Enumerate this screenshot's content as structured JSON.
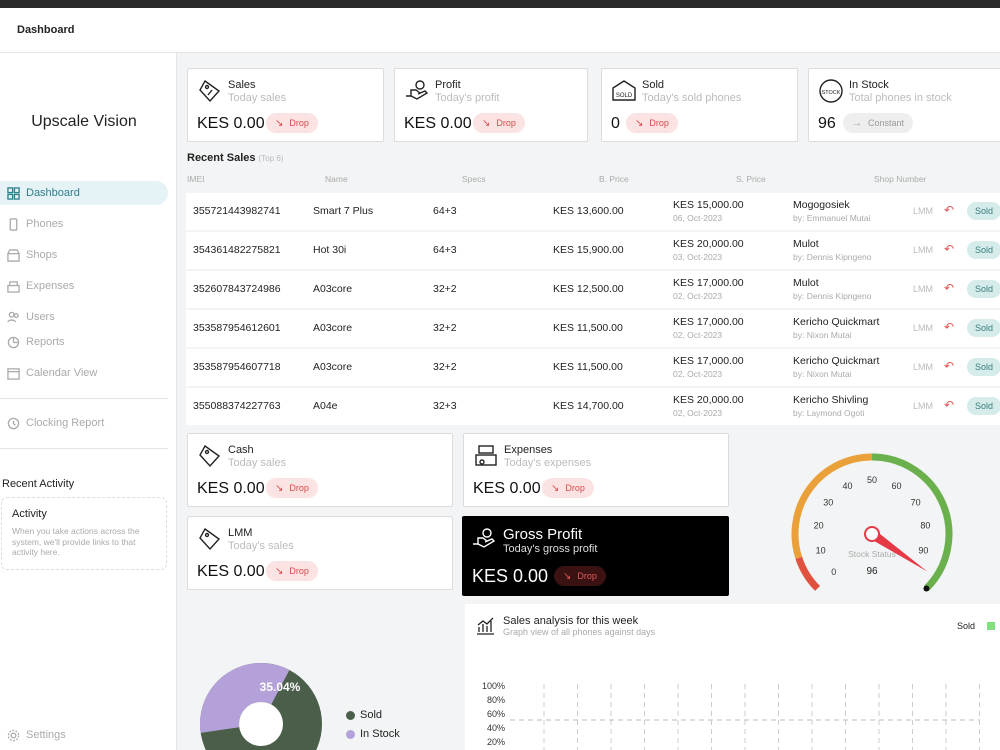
{
  "topbar": {
    "title": "Dashboard"
  },
  "brand": "Upscale Vision",
  "nav": [
    {
      "label": "Dashboard",
      "icon": "grid-icon",
      "active": true
    },
    {
      "label": "Phones",
      "icon": "phone-icon"
    },
    {
      "label": "Shops",
      "icon": "shop-icon"
    },
    {
      "label": "Expenses",
      "icon": "expenses-icon"
    },
    {
      "label": "Users",
      "icon": "users-icon"
    },
    {
      "label": "Reports",
      "icon": "reports-icon"
    },
    {
      "label": "Calendar View",
      "icon": "calendar-icon"
    },
    {
      "label": "Clocking Report",
      "icon": "clock-icon"
    },
    {
      "label": "Settings",
      "icon": "gear-icon"
    }
  ],
  "recent_activity": {
    "title": "Recent Activity",
    "box_title": "Activity",
    "box_text": "When you take actions across the system, we'll provide links to that activity here."
  },
  "stats": [
    {
      "title": "Sales",
      "subtitle": "Today sales",
      "value": "KES 0.00",
      "badge": "Drop",
      "icon": "sales-tag-icon"
    },
    {
      "title": "Profit",
      "subtitle": "Today's profit",
      "value": "KES 0.00",
      "badge": "Drop",
      "icon": "profit-hand-icon"
    },
    {
      "title": "Sold",
      "subtitle": "Today's sold phones",
      "value": "0",
      "badge": "Drop",
      "icon": "sold-stamp-icon"
    },
    {
      "title": "In Stock",
      "subtitle": "Total phones in stock",
      "value": "96",
      "badge": "Constant",
      "icon": "stock-stamp-icon"
    }
  ],
  "recent_sales": {
    "title": "Recent Sales",
    "hint": "(Top 6)",
    "headers": [
      "IMEI",
      "Name",
      "Specs",
      "B. Price",
      "S. Price",
      "Shop Number"
    ],
    "rows": [
      {
        "imei": "355721443982741",
        "name": "Smart 7 Plus",
        "specs": "64+3",
        "bprice": "KES 13,600.00",
        "sprice": "KES 15,000.00",
        "date": "06, Oct-2023",
        "shop": "Mogogosiek",
        "by": "by: Emmanuel Mutai",
        "lmm": "LMM",
        "status": "Sold"
      },
      {
        "imei": "354361482275821",
        "name": "Hot 30i",
        "specs": "64+3",
        "bprice": "KES 15,900.00",
        "sprice": "KES 20,000.00",
        "date": "03, Oct-2023",
        "shop": "Mulot",
        "by": "by: Dennis  Kipngeno",
        "lmm": "LMM",
        "status": "Sold"
      },
      {
        "imei": "352607843724986",
        "name": "A03core",
        "specs": "32+2",
        "bprice": "KES 12,500.00",
        "sprice": "KES 17,000.00",
        "date": "02, Oct-2023",
        "shop": "Mulot",
        "by": "by: Dennis  Kipngeno",
        "lmm": "LMM",
        "status": "Sold"
      },
      {
        "imei": "353587954612601",
        "name": "A03core",
        "specs": "32+2",
        "bprice": "KES 11,500.00",
        "sprice": "KES 17,000.00",
        "date": "02, Oct-2023",
        "shop": "Kericho Quickmart",
        "by": "by: Nixon  Mutai",
        "lmm": "LMM",
        "status": "Sold"
      },
      {
        "imei": "353587954607718",
        "name": "A03core",
        "specs": "32+2",
        "bprice": "KES 11,500.00",
        "sprice": "KES 17,000.00",
        "date": "02, Oct-2023",
        "shop": "Kericho Quickmart",
        "by": "by: Nixon  Mutai",
        "lmm": "LMM",
        "status": "Sold"
      },
      {
        "imei": "355088374227763",
        "name": "A04e",
        "specs": "32+3",
        "bprice": "KES 14,700.00",
        "sprice": "KES 20,000.00",
        "date": "02, Oct-2023",
        "shop": "Kericho Shivling",
        "by": "by: Laymond  Ogoti",
        "lmm": "LMM",
        "status": "Sold"
      }
    ]
  },
  "cards2": [
    {
      "title": "Cash",
      "subtitle": "Today sales",
      "value": "KES 0.00",
      "badge": "Drop",
      "icon": "cash-tag-icon"
    },
    {
      "title": "Expenses",
      "subtitle": "Today's expenses",
      "value": "KES 0.00",
      "badge": "Drop",
      "icon": "expenses-register-icon"
    },
    {
      "title": "LMM",
      "subtitle": "Today's sales",
      "value": "KES 0.00",
      "badge": "Drop",
      "icon": "lmm-tag-icon"
    }
  ],
  "gross": {
    "title": "Gross Profit",
    "subtitle": "Today's gross profit",
    "value": "KES 0.00",
    "badge": "Drop",
    "icon": "gross-hand-icon"
  },
  "gauge": {
    "label": "Stock Status",
    "value": "96",
    "reading": 96,
    "min": 0,
    "max": 100,
    "ticks": [
      "0",
      "10",
      "20",
      "30",
      "40",
      "50",
      "60",
      "70",
      "80",
      "90"
    ],
    "colors": {
      "low": "#e0523f",
      "mid": "#eba13a",
      "high": "#6ab04c",
      "needle": "#e53946"
    }
  },
  "pie": {
    "percent_label": "35.04%",
    "legend": [
      "Sold",
      "In Stock"
    ],
    "colors": {
      "sold": "#4a5e4a",
      "instock": "#b5a1d9"
    },
    "instock_pct": 35.04
  },
  "analysis": {
    "title": "Sales analysis for this week",
    "subtitle": "Graph view of all phones against days",
    "legend": "Sold",
    "legend_color": "#7ee07e",
    "yticks": [
      "100%",
      "80%",
      "60%",
      "40%",
      "20%"
    ],
    "icon": "chart-icon"
  }
}
